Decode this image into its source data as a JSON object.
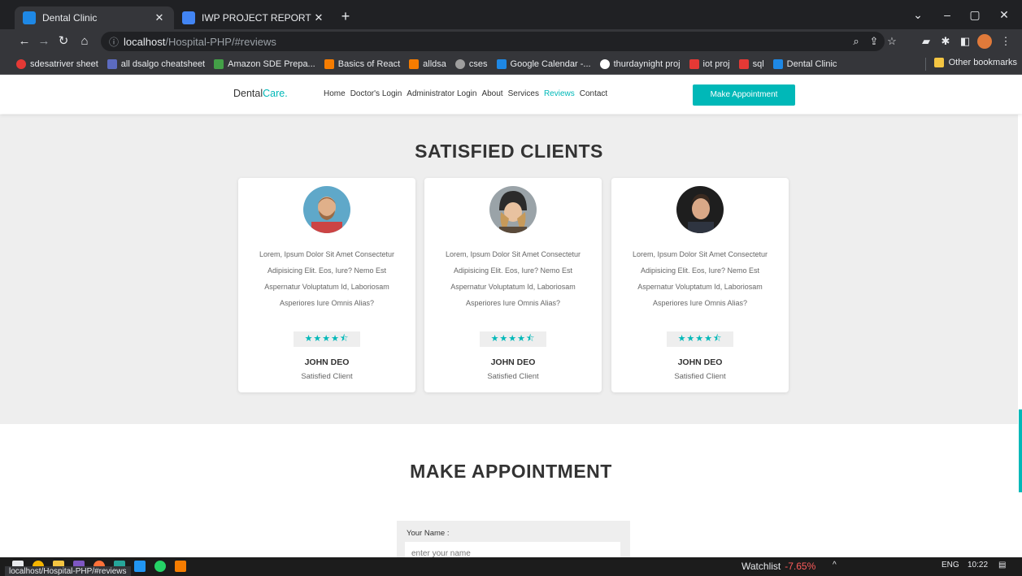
{
  "tabs": [
    {
      "title": "Dental Clinic",
      "active": true,
      "icon": "dental-favicon"
    },
    {
      "title": "IWP PROJECT REPORT - Google D",
      "active": false,
      "icon": "google-docs-icon"
    }
  ],
  "address": {
    "host": "localhost",
    "path": "/Hospital-PHP/#reviews"
  },
  "bookmarks": [
    {
      "label": "sdesatriver sheet",
      "color": "#e53935"
    },
    {
      "label": "all dsalgo cheatsheet",
      "color": "#5c6bc0"
    },
    {
      "label": "Amazon SDE Prepa...",
      "color": "#43a047"
    },
    {
      "label": "Basics of React",
      "color": "#f57c00"
    },
    {
      "label": "alldsa",
      "color": "#f57c00"
    },
    {
      "label": "cses",
      "color": "#9e9e9e"
    },
    {
      "label": "Google Calendar -...",
      "color": "#1e88e5"
    },
    {
      "label": "thurdaynight proj",
      "color": "#ffffff"
    },
    {
      "label": "iot proj",
      "color": "#e53935"
    },
    {
      "label": "sql",
      "color": "#e53935"
    },
    {
      "label": "Dental Clinic",
      "color": "#1e88e5"
    }
  ],
  "other_bookmarks": "Other bookmarks",
  "site": {
    "logo_main": "Dental",
    "logo_accent": "Care.",
    "nav": [
      "Home",
      "Doctor's Login",
      "Administrator Login",
      "About",
      "Services",
      "Reviews",
      "Contact"
    ],
    "active_nav": "Reviews",
    "cta": "Make Appointment"
  },
  "reviews": {
    "title": "SATISFIED CLIENTS",
    "cards": [
      {
        "text": "Lorem, Ipsum Dolor Sit Amet Consectetur Adipisicing Elit. Eos, Iure? Nemo Est Aspernatur Voluptatum Id, Laboriosam Asperiores Iure Omnis Alias?",
        "stars": "★★★★⯪",
        "rating": 4.5,
        "name": "JOHN DEO",
        "role": "Satisfied Client"
      },
      {
        "text": "Lorem, Ipsum Dolor Sit Amet Consectetur Adipisicing Elit. Eos, Iure? Nemo Est Aspernatur Voluptatum Id, Laboriosam Asperiores Iure Omnis Alias?",
        "stars": "★★★★⯪",
        "rating": 4.5,
        "name": "JOHN DEO",
        "role": "Satisfied Client"
      },
      {
        "text": "Lorem, Ipsum Dolor Sit Amet Consectetur Adipisicing Elit. Eos, Iure? Nemo Est Aspernatur Voluptatum Id, Laboriosam Asperiores Iure Omnis Alias?",
        "stars": "★★★★⯪",
        "rating": 4.5,
        "name": "JOHN DEO",
        "role": "Satisfied Client"
      }
    ]
  },
  "appointment": {
    "title": "MAKE APPOINTMENT",
    "name_label": "Your Name :",
    "name_placeholder": "enter your name"
  },
  "status_bar": "localhost/Hospital-PHP/#reviews",
  "taskbar": {
    "watchlist": "Watchlist",
    "change": "-7.65%",
    "lang": "ENG",
    "time": "10:22"
  },
  "colors": {
    "accent": "#00b8b8",
    "section_bg": "#eeeeee"
  }
}
